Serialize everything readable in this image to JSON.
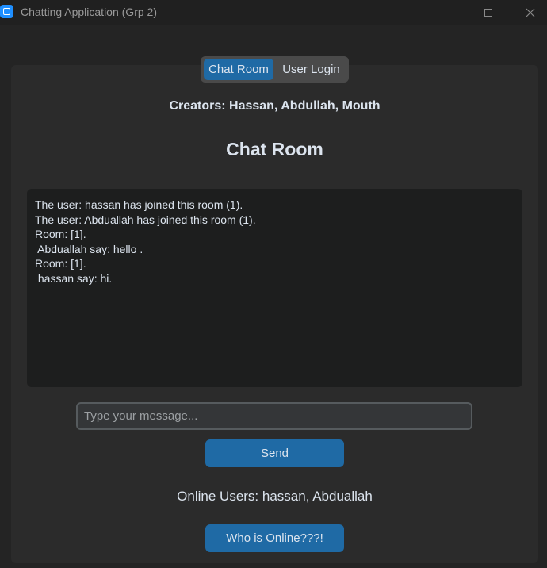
{
  "window": {
    "title": "Chatting Application (Grp 2)",
    "icon": "app-icon"
  },
  "tabs": [
    {
      "label": "Chat Room",
      "selected": true
    },
    {
      "label": "User Login",
      "selected": false
    }
  ],
  "header": {
    "creators": "Creators: Hassan, Abdullah, Mouth",
    "room_title": "Chat Room"
  },
  "chat": {
    "lines": [
      "The user: hassan has joined this room (1).",
      "The user: Abduallah has joined this room (1).",
      "Room: [1].",
      " Abduallah say: hello .",
      "Room: [1].",
      " hassan say: hi."
    ]
  },
  "input": {
    "placeholder": "Type your message...",
    "value": ""
  },
  "buttons": {
    "send": "Send",
    "who_online": "Who is Online???!"
  },
  "online_users": "Online Users: hassan, Abduallah",
  "colors": {
    "accent": "#1f6aa5",
    "background": "#242424",
    "panel": "#2b2b2b",
    "textbox": "#1d1e1e"
  }
}
